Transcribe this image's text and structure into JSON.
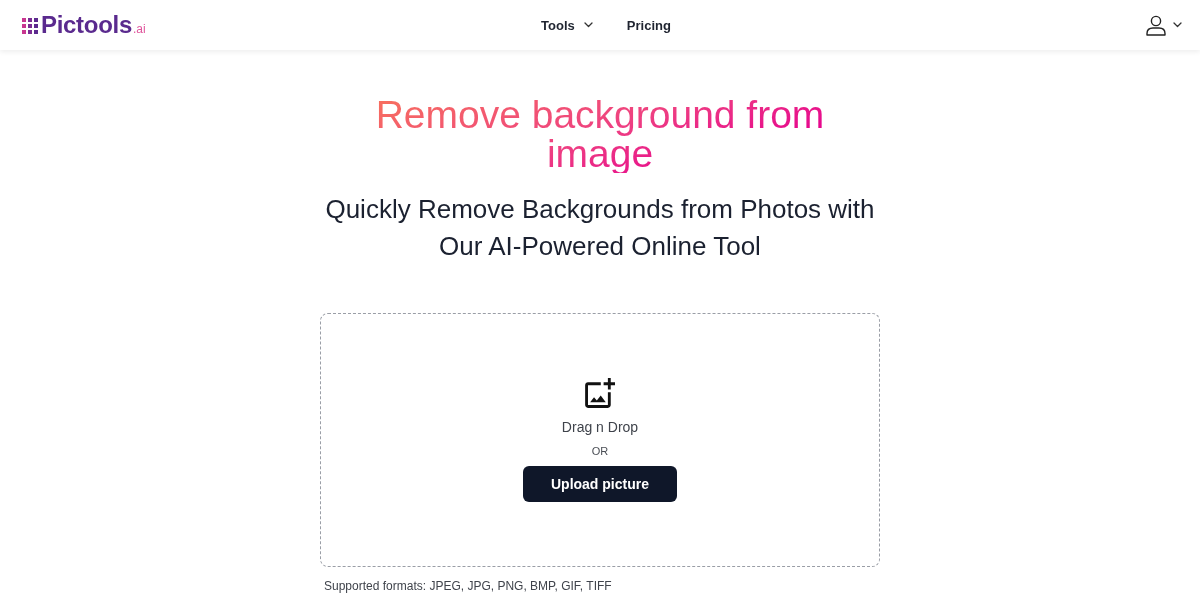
{
  "header": {
    "logo": {
      "name": "Pictools",
      "suffix": ".ai"
    },
    "nav": [
      {
        "label": "Tools",
        "kind": "dropdown"
      },
      {
        "label": "Pricing",
        "kind": "link"
      }
    ]
  },
  "hero": {
    "title": "Remove background from image",
    "subtitle": "Quickly Remove Backgrounds from Photos with Our AI-Powered Online Tool"
  },
  "upload": {
    "prompt": "Drag n Drop",
    "separator": "OR",
    "button": "Upload picture",
    "note": "Supported formats: JPEG, JPG, PNG, BMP, GIF, TIFF"
  }
}
